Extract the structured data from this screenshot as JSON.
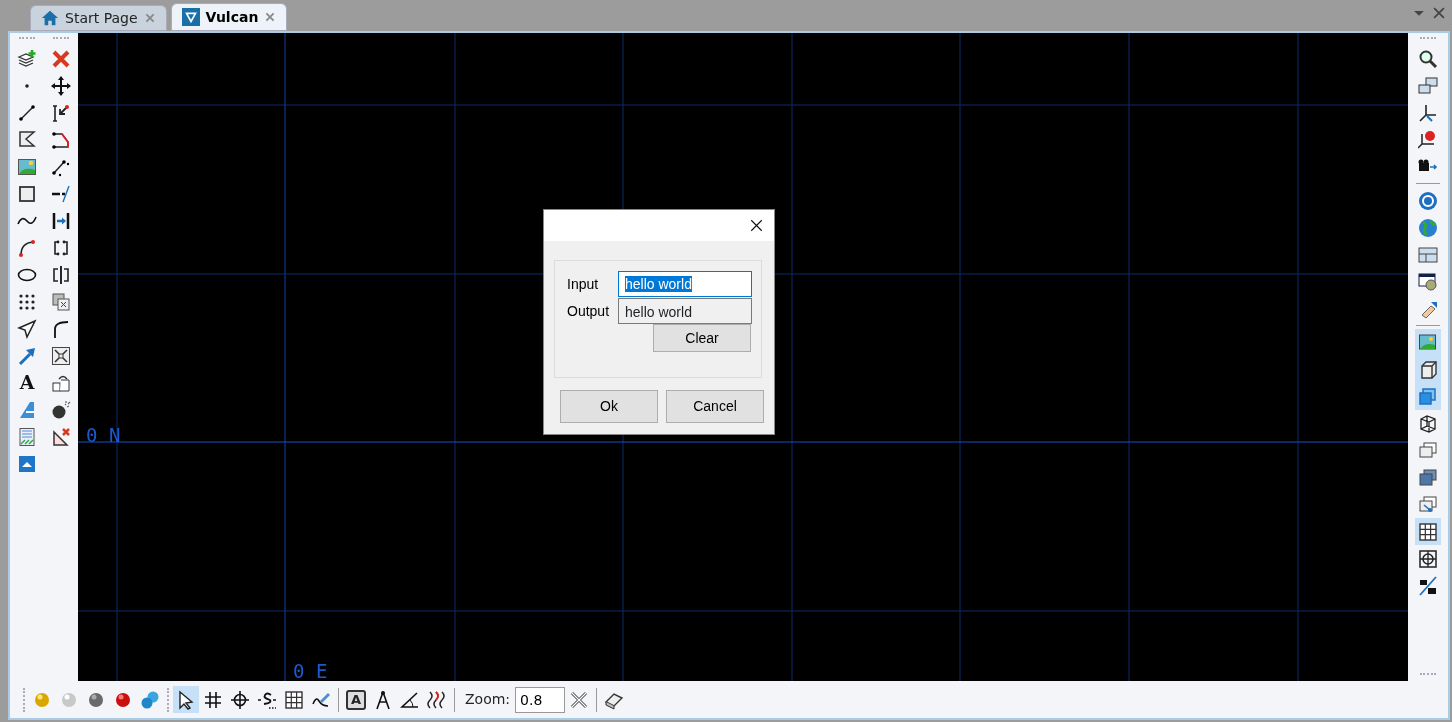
{
  "tabs": [
    {
      "label": "Start Page",
      "selected": false
    },
    {
      "label": "Vulcan",
      "selected": true
    }
  ],
  "left_toolbar": {
    "text_tool_glyph": "A"
  },
  "right_toolbar": {
    "groups": [
      [
        {
          "on": false
        },
        {
          "on": false
        },
        {
          "on": false
        },
        {
          "on": false
        },
        {
          "on": false
        }
      ],
      [
        {
          "on": false
        },
        {
          "on": false
        },
        {
          "on": false
        },
        {
          "on": false
        },
        {
          "on": false
        }
      ],
      [
        {
          "on": true
        },
        {
          "on": true
        },
        {
          "on": true
        },
        {
          "on": false
        },
        {
          "on": false
        },
        {
          "on": false
        },
        {
          "on": false
        },
        {
          "on": true
        },
        {
          "on": false
        },
        {
          "on": false
        }
      ]
    ]
  },
  "canvas": {
    "north_label": "0 N",
    "east_label": "0 E"
  },
  "dialog": {
    "input_label": "Input",
    "input_value": "hello world",
    "output_label": "Output",
    "output_value": "hello world",
    "clear_button": "Clear",
    "ok_button": "Ok",
    "cancel_button": "Cancel"
  },
  "bottom_toolbar": {
    "tools": [
      {
        "on": true
      },
      {
        "on": false
      },
      {
        "on": false
      },
      {
        "on": false
      },
      {
        "on": false
      },
      {
        "on": false
      }
    ],
    "text_box_glyph": "A",
    "zoom_label": "Zoom:",
    "zoom_value": "0.8"
  }
}
